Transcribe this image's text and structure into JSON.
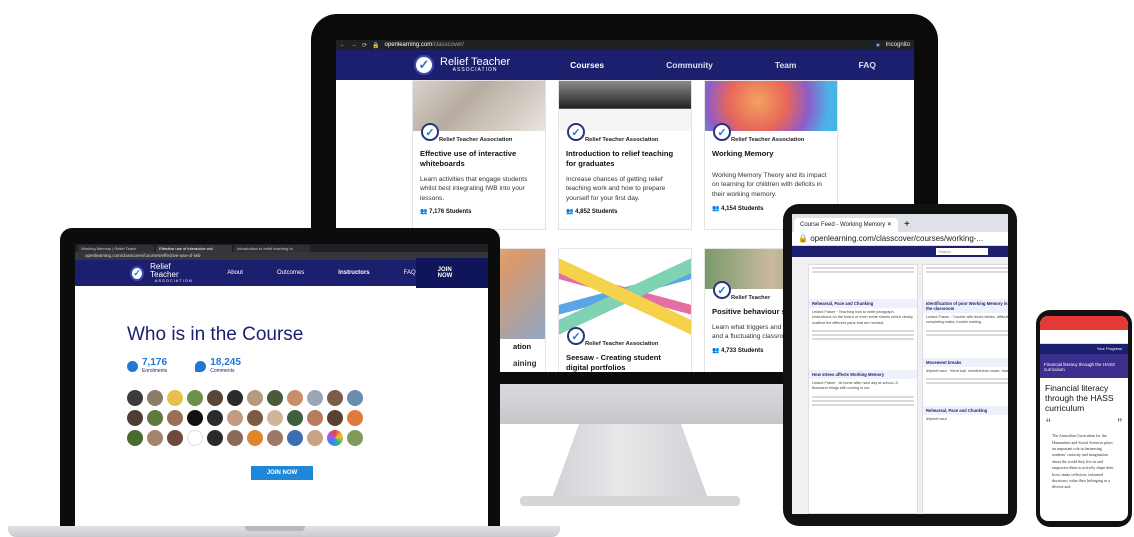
{
  "imac": {
    "url_host": "openlearning.com",
    "url_path": "/classcover/",
    "incognito_label": "Incognito",
    "logo_line1": "Relief Teacher",
    "logo_line2": "ASSOCIATION",
    "nav": [
      "Courses",
      "Community",
      "Team",
      "FAQ"
    ],
    "cards": [
      {
        "org": "Relief Teacher Association",
        "title": "Effective use of interactive whiteboards",
        "desc": "Learn activities that engage students whilst best integrating IWB into your lessons.",
        "students": "7,176 Students"
      },
      {
        "org": "Relief Teacher Association",
        "title": "Introduction to relief teaching for graduates",
        "desc": "Increase chances of getting relief teaching work and how to prepare yourself for your first day.",
        "students": "4,852 Students"
      },
      {
        "org": "Relief Teacher Association",
        "title": "Working Memory",
        "desc": "Working Memory Theory and its impact on learning for children with deficits in their working memory.",
        "students": "4,154 Students"
      },
      {
        "org": "",
        "title": "ation",
        "desc": "aining",
        "students": ""
      },
      {
        "org": "Relief Teacher Association",
        "title": "Seesaw - Creating student digital portfolios",
        "desc": "",
        "students": ""
      },
      {
        "org": "Relief Teacher",
        "title": "Positive behaviour strategies",
        "desc": "Learn what triggers and how to read and a fluctuating classroom.",
        "students": "4,733 Students"
      }
    ],
    "colors": {
      "nav_bg": "#1b1f6d",
      "accent": "#1f78d1"
    }
  },
  "laptop": {
    "tabs": [
      "Working Memory | Relief Teach",
      "Effective use of interactive whi",
      "Introduction to relief teaching fo"
    ],
    "url": "openlearning.com/classcover/courses/effective-use-of-iwb",
    "logo_line1": "Relief Teacher",
    "logo_line2": "ASSOCIATION",
    "nav": [
      "About",
      "Outcomes",
      "Instructors",
      "FAQ"
    ],
    "join_top": "JOIN NOW",
    "heading": "Who is in the Course",
    "enrolments_num": "7,176",
    "enrolments_label": "Enrolments",
    "comments_num": "18,245",
    "comments_label": "Comments",
    "join_button": "JOIN NOW"
  },
  "tablet": {
    "tab_title": "Course Feed - Working Memory",
    "url": "openlearning.com/classcover/courses/working-...",
    "search_placeholder": "Search",
    "posts": [
      {
        "heading": "Rehearsal, Pace and Chunking",
        "text": "Leland Fraser · Teaching how to write paragraph. Instructions on the board or even some sheets which clearly scaffold the different parts that are needed."
      },
      {
        "heading": "How stress affects Working Memory",
        "text": "Leland Fraser · At home after hard day at school. A thousand things still running in me."
      },
      {
        "heading": "Identification of poor Working Memory in the classroom",
        "text": "Leland Fraser · Trouble with times tables, difficulty completing tasks, trouble waiting."
      },
      {
        "heading": "Movement breaks",
        "text": "dilpreet kaur · Went ball, mindfulness music, drama"
      },
      {
        "heading": "Rehearsal, Pace and Chunking",
        "text": "dilpreet kaur"
      }
    ]
  },
  "phone": {
    "hero": "Financial literacy through the HASS curriculum",
    "title": "Financial literacy through the HASS curriculum",
    "progress_label": "Your Progress",
    "body": "The Australian Curriculum for the Humanities and Social Sciences plays an important role in harnessing students' curiosity and imagination about the world they live in and empowers them to actively shape their lives; make reflective, informed decisions; value their belonging in a diverse and"
  }
}
